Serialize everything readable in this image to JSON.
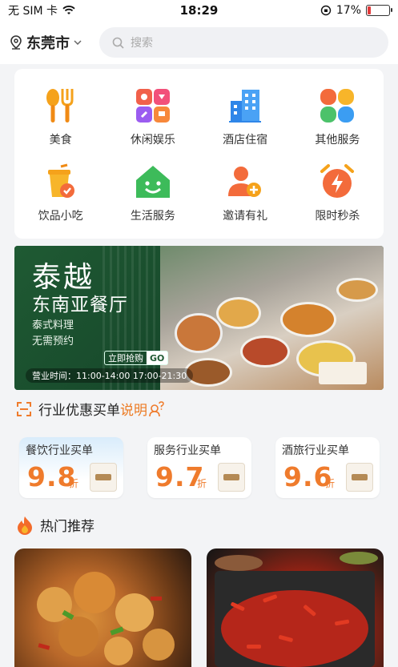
{
  "status_bar": {
    "carrier": "无 SIM 卡",
    "time": "18:29",
    "battery": "17%",
    "battery_level": 0.17
  },
  "header": {
    "city": "东莞市",
    "search_placeholder": "搜索"
  },
  "categories": [
    {
      "label": "美食",
      "icon": "cutlery-icon"
    },
    {
      "label": "休闲娱乐",
      "icon": "entertainment-icon"
    },
    {
      "label": "酒店住宿",
      "icon": "hotel-building-icon"
    },
    {
      "label": "其他服务",
      "icon": "four-petals-icon"
    },
    {
      "label": "饮品小吃",
      "icon": "drink-cup-icon"
    },
    {
      "label": "生活服务",
      "icon": "house-smile-icon"
    },
    {
      "label": "邀请有礼",
      "icon": "invite-user-icon"
    },
    {
      "label": "限时秒杀",
      "icon": "alarm-clock-icon"
    }
  ],
  "banner": {
    "title": "泰越",
    "subtitle": "东南亚餐厅",
    "line1": "泰式料理",
    "line2": "无需预约",
    "cta": "立即抢购",
    "cta_go": "GO",
    "hours": "营业时间：11:00-14:00 17:00-21:30"
  },
  "discount_section": {
    "title": "行业优惠买单",
    "link": "说明"
  },
  "vouchers": [
    {
      "name": "餐饮行业买单",
      "value": "9.8",
      "unit": "折"
    },
    {
      "name": "服务行业买单",
      "value": "9.7",
      "unit": "折"
    },
    {
      "name": "酒旅行业买单",
      "value": "9.6",
      "unit": "折"
    }
  ],
  "hot_section": {
    "title": "热门推荐"
  },
  "colors": {
    "accent": "#ef7b2c",
    "banner_green": "#1f5a33"
  }
}
